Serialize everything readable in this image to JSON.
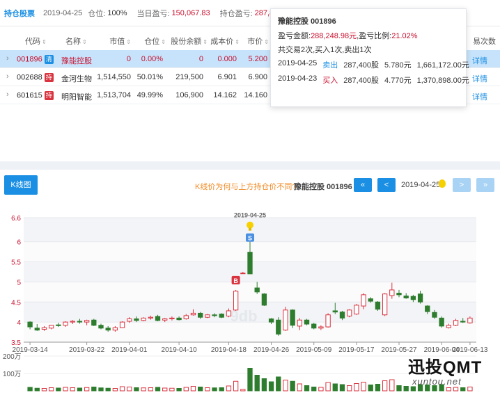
{
  "holdings": {
    "tab": "持仓股票",
    "date": "2019-04-25",
    "position_label": "仓位:",
    "position_value": "100%",
    "daily_pnl_label": "当日盈亏:",
    "daily_pnl_value": "150,067.83",
    "holding_pnl_label": "持仓盈亏:",
    "holding_pnl_value": "287,855.3",
    "columns": [
      "代码",
      "名称",
      "市值",
      "仓位",
      "股份余额",
      "成本价",
      "市价"
    ],
    "extra_column": "易次数",
    "detail_label": "详情",
    "rows": [
      {
        "code": "001896",
        "badge": "清",
        "badge_color": "#1a8fe3",
        "name": "豫能控股",
        "market_value": "0",
        "position": "0.00%",
        "shares": "0",
        "cost": "0.000",
        "price": "5.200"
      },
      {
        "code": "002688",
        "badge": "持",
        "badge_color": "#d9333f",
        "name": "金河生物",
        "market_value": "1,514,550",
        "position": "50.01%",
        "shares": "219,500",
        "cost": "6.901",
        "price": "6.900"
      },
      {
        "code": "601615",
        "badge": "持",
        "badge_color": "#d9333f",
        "name": "明阳智能",
        "market_value": "1,513,704",
        "position": "49.99%",
        "shares": "106,900",
        "cost": "14.162",
        "price": "14.160"
      }
    ]
  },
  "tooltip": {
    "title": "豫能控股 001896",
    "pnl_label": "盈亏金额:",
    "pnl_value": "288,248.98元",
    "ratio_label": ",盈亏比例:",
    "ratio_value": "21.02%",
    "summary": "共交易2次,买入1次,卖出1次",
    "trades": [
      {
        "date": "2019-04-25",
        "side": "卖出",
        "type": "sell",
        "shares": "287,400股",
        "price": "5.780元",
        "amount": "1,661,172.00元"
      },
      {
        "date": "2019-04-23",
        "side": "买入",
        "type": "buy",
        "shares": "287,400股",
        "price": "4.770元",
        "amount": "1,370,898.00元"
      }
    ]
  },
  "kpanel": {
    "tab": "K线图",
    "question": "K线价为何与上方持仓价不同?",
    "stock": "豫能控股 001896",
    "first_btn": "«",
    "prev_btn": "<",
    "date": "2019-04-25",
    "next_btn": ">",
    "last_btn": "»"
  },
  "watermark": {
    "big": "迅投QMT",
    "small": "xuntou.net"
  },
  "chart_data": {
    "type": "candlestick",
    "ylim": [
      3.5,
      6.6
    ],
    "yticks": [
      "6.6",
      "6",
      "5.5",
      "5",
      "4.5",
      "4",
      "3.5"
    ],
    "ytick_values": [
      6.6,
      6.0,
      5.5,
      5.0,
      4.5,
      4.0,
      3.5
    ],
    "xticks": [
      "2019-03-14",
      "2019-03-22",
      "2019-04-01",
      "2019-04-10",
      "2019-04-18",
      "2019-04-26",
      "2019-05-09",
      "2019-05-17",
      "2019-05-27",
      "2019-06-04",
      "2019-06-13"
    ],
    "volume_ticks": [
      "200万",
      "100万"
    ],
    "volume_tick_values": [
      2000000,
      1000000
    ],
    "marker_date": "2019-04-25",
    "buy_marker": "B",
    "sell_marker": "S",
    "candles": [
      {
        "o": 4.0,
        "h": 4.02,
        "l": 3.82,
        "c": 3.88,
        "v": 20
      },
      {
        "o": 3.85,
        "h": 3.95,
        "l": 3.78,
        "c": 3.8,
        "v": 15
      },
      {
        "o": 3.82,
        "h": 3.9,
        "l": 3.78,
        "c": 3.86,
        "v": 14
      },
      {
        "o": 3.85,
        "h": 3.93,
        "l": 3.82,
        "c": 3.92,
        "v": 18
      },
      {
        "o": 3.93,
        "h": 3.98,
        "l": 3.88,
        "c": 3.91,
        "v": 16
      },
      {
        "o": 3.92,
        "h": 4.02,
        "l": 3.88,
        "c": 4.0,
        "v": 20
      },
      {
        "o": 4.0,
        "h": 4.05,
        "l": 3.95,
        "c": 4.02,
        "v": 18
      },
      {
        "o": 4.02,
        "h": 4.08,
        "l": 3.96,
        "c": 4.0,
        "v": 16
      },
      {
        "o": 4.0,
        "h": 4.06,
        "l": 3.92,
        "c": 4.04,
        "v": 19
      },
      {
        "o": 4.05,
        "h": 4.08,
        "l": 3.9,
        "c": 3.92,
        "v": 22
      },
      {
        "o": 3.92,
        "h": 3.96,
        "l": 3.82,
        "c": 3.85,
        "v": 17
      },
      {
        "o": 3.85,
        "h": 3.9,
        "l": 3.76,
        "c": 3.8,
        "v": 15
      },
      {
        "o": 3.8,
        "h": 3.9,
        "l": 3.76,
        "c": 3.86,
        "v": 14
      },
      {
        "o": 3.86,
        "h": 4.02,
        "l": 3.85,
        "c": 4.0,
        "v": 24
      },
      {
        "o": 4.02,
        "h": 4.12,
        "l": 3.98,
        "c": 4.08,
        "v": 22
      },
      {
        "o": 4.08,
        "h": 4.14,
        "l": 4.0,
        "c": 4.04,
        "v": 18
      },
      {
        "o": 4.04,
        "h": 4.12,
        "l": 4.02,
        "c": 4.1,
        "v": 17
      },
      {
        "o": 4.1,
        "h": 4.16,
        "l": 4.06,
        "c": 4.12,
        "v": 18
      },
      {
        "o": 4.14,
        "h": 4.18,
        "l": 4.02,
        "c": 4.04,
        "v": 20
      },
      {
        "o": 4.05,
        "h": 4.1,
        "l": 4.0,
        "c": 4.08,
        "v": 16
      },
      {
        "o": 4.08,
        "h": 4.14,
        "l": 4.04,
        "c": 4.1,
        "v": 15
      },
      {
        "o": 4.1,
        "h": 4.14,
        "l": 4.04,
        "c": 4.06,
        "v": 14
      },
      {
        "o": 4.08,
        "h": 4.2,
        "l": 4.06,
        "c": 4.16,
        "v": 20
      },
      {
        "o": 4.18,
        "h": 4.32,
        "l": 4.16,
        "c": 4.22,
        "v": 26
      },
      {
        "o": 4.22,
        "h": 4.25,
        "l": 4.08,
        "c": 4.12,
        "v": 22
      },
      {
        "o": 4.12,
        "h": 4.2,
        "l": 4.1,
        "c": 4.18,
        "v": 18
      },
      {
        "o": 4.18,
        "h": 4.22,
        "l": 4.12,
        "c": 4.16,
        "v": 17
      },
      {
        "o": 4.2,
        "h": 4.22,
        "l": 4.1,
        "c": 4.12,
        "v": 18
      },
      {
        "o": 4.15,
        "h": 4.34,
        "l": 4.12,
        "c": 4.28,
        "v": 28
      },
      {
        "o": 4.3,
        "h": 4.8,
        "l": 4.28,
        "c": 4.77,
        "v": 55
      },
      {
        "o": 5.22,
        "h": 5.25,
        "l": 5.2,
        "c": 5.22,
        "v": 8
      },
      {
        "o": 5.74,
        "h": 6.0,
        "l": 5.2,
        "c": 5.2,
        "v": 130
      },
      {
        "o": 4.85,
        "h": 5.0,
        "l": 4.7,
        "c": 4.75,
        "v": 90
      },
      {
        "o": 4.7,
        "h": 4.72,
        "l": 4.4,
        "c": 4.42,
        "v": 70
      },
      {
        "o": 4.08,
        "h": 4.1,
        "l": 3.95,
        "c": 4.0,
        "v": 52
      },
      {
        "o": 4.05,
        "h": 4.12,
        "l": 3.66,
        "c": 3.7,
        "v": 80
      },
      {
        "o": 3.8,
        "h": 4.38,
        "l": 3.78,
        "c": 4.3,
        "v": 62
      },
      {
        "o": 4.3,
        "h": 4.32,
        "l": 3.85,
        "c": 3.92,
        "v": 55
      },
      {
        "o": 3.9,
        "h": 4.1,
        "l": 3.8,
        "c": 4.05,
        "v": 40
      },
      {
        "o": 4.05,
        "h": 4.08,
        "l": 3.92,
        "c": 3.95,
        "v": 30
      },
      {
        "o": 3.95,
        "h": 3.98,
        "l": 3.82,
        "c": 3.85,
        "v": 22
      },
      {
        "o": 3.85,
        "h": 3.92,
        "l": 3.8,
        "c": 3.88,
        "v": 20
      },
      {
        "o": 3.88,
        "h": 4.22,
        "l": 3.86,
        "c": 4.18,
        "v": 48
      },
      {
        "o": 4.28,
        "h": 4.48,
        "l": 4.2,
        "c": 4.25,
        "v": 40
      },
      {
        "o": 4.25,
        "h": 4.28,
        "l": 4.05,
        "c": 4.1,
        "v": 36
      },
      {
        "o": 4.15,
        "h": 4.32,
        "l": 4.12,
        "c": 4.3,
        "v": 30
      },
      {
        "o": 4.2,
        "h": 4.45,
        "l": 4.18,
        "c": 4.42,
        "v": 42
      },
      {
        "o": 4.4,
        "h": 4.72,
        "l": 4.32,
        "c": 4.68,
        "v": 50
      },
      {
        "o": 4.58,
        "h": 4.62,
        "l": 4.48,
        "c": 4.52,
        "v": 34
      },
      {
        "o": 4.5,
        "h": 4.52,
        "l": 4.28,
        "c": 4.32,
        "v": 38
      },
      {
        "o": 4.18,
        "h": 4.72,
        "l": 4.15,
        "c": 4.7,
        "v": 58
      },
      {
        "o": 4.66,
        "h": 4.98,
        "l": 4.58,
        "c": 4.8,
        "v": 64
      },
      {
        "o": 4.72,
        "h": 4.8,
        "l": 4.62,
        "c": 4.68,
        "v": 30
      },
      {
        "o": 4.65,
        "h": 4.72,
        "l": 4.58,
        "c": 4.6,
        "v": 26
      },
      {
        "o": 4.64,
        "h": 4.68,
        "l": 4.5,
        "c": 4.56,
        "v": 24
      },
      {
        "o": 4.7,
        "h": 4.78,
        "l": 4.46,
        "c": 4.5,
        "v": 36
      },
      {
        "o": 4.4,
        "h": 4.42,
        "l": 4.2,
        "c": 4.26,
        "v": 34
      },
      {
        "o": 4.24,
        "h": 4.3,
        "l": 4.08,
        "c": 4.12,
        "v": 30
      },
      {
        "o": 4.1,
        "h": 4.14,
        "l": 3.86,
        "c": 3.9,
        "v": 36
      },
      {
        "o": 3.86,
        "h": 3.96,
        "l": 3.84,
        "c": 3.92,
        "v": 18
      },
      {
        "o": 3.92,
        "h": 4.08,
        "l": 3.9,
        "c": 4.04,
        "v": 20
      },
      {
        "o": 4.02,
        "h": 4.1,
        "l": 3.98,
        "c": 4.0,
        "v": 18
      },
      {
        "o": 3.98,
        "h": 4.14,
        "l": 3.96,
        "c": 4.1,
        "v": 22
      }
    ]
  }
}
